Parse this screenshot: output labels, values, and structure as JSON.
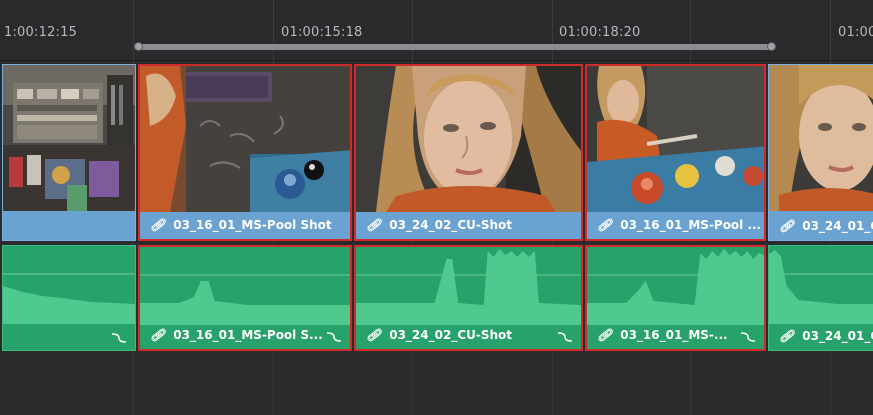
{
  "ruler": {
    "timecodes": [
      "1:00:12:15",
      "01:00:15:18",
      "01:00:18:20",
      "01:00"
    ]
  },
  "tracks": {
    "video": [
      {
        "name": "",
        "selected": false
      },
      {
        "name": "03_16_01_MS-Pool Shot",
        "selected": true
      },
      {
        "name": "03_24_02_CU-Shot",
        "selected": true
      },
      {
        "name": "03_16_01_MS-Pool ...",
        "selected": true
      },
      {
        "name": "03_24_01_C",
        "selected": false
      }
    ],
    "audio": [
      {
        "name": "",
        "selected": false
      },
      {
        "name": "03_16_01_MS-Pool S...",
        "selected": true
      },
      {
        "name": "03_24_02_CU-Shot",
        "selected": true
      },
      {
        "name": "03_16_01_MS-...",
        "selected": true
      },
      {
        "name": "03_24_01_C",
        "selected": false
      }
    ]
  },
  "colors": {
    "video_clip": "#6aa4d3",
    "audio_clip": "#27a26a",
    "selection_border": "#d02b2b",
    "background": "#2b2b2e"
  },
  "icons": {
    "link": "link-icon",
    "fade": "fade-curve-icon"
  }
}
